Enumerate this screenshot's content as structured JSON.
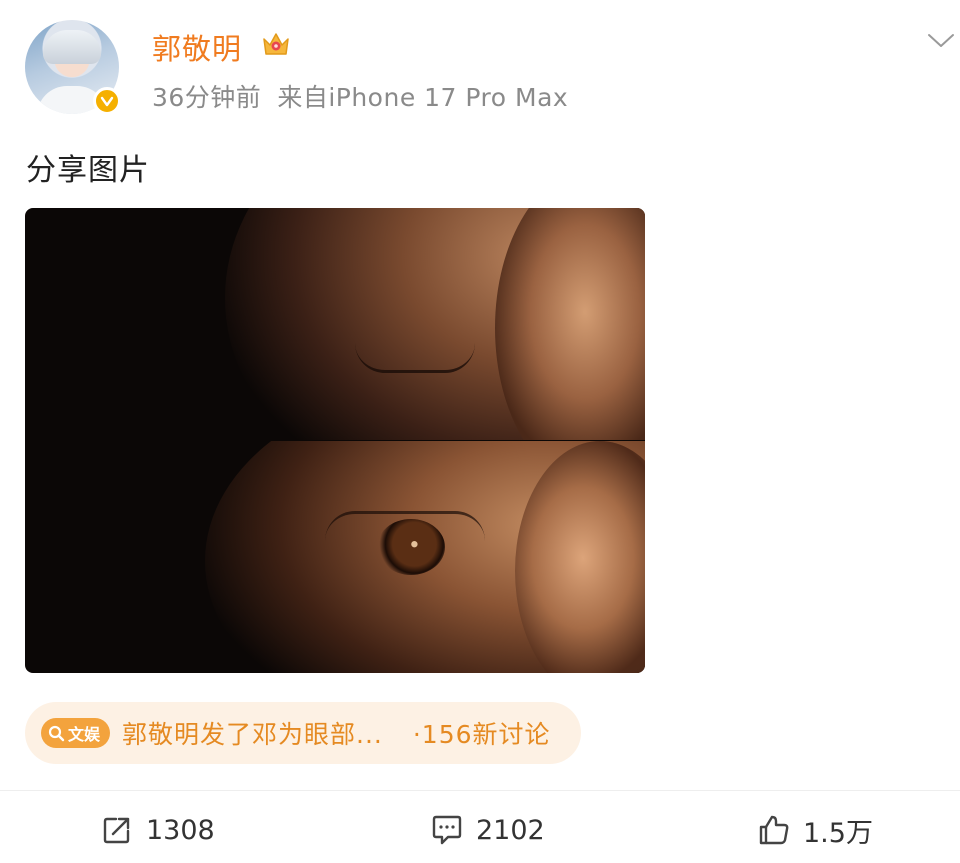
{
  "post": {
    "author": "郭敬明",
    "time": "36分钟前",
    "source": "来自iPhone 17 Pro Max",
    "text": "分享图片"
  },
  "topic": {
    "badge": "文娱",
    "title": "郭敬明发了邓为眼部...",
    "count": "·156新讨论"
  },
  "actions": {
    "reposts": "1308",
    "comments": "2102",
    "likes": "1.5万"
  },
  "colors": {
    "username": "#f07b1f",
    "topic_text": "#e58a22",
    "topic_bg": "#fdf1e4",
    "badge_bg": "#f3a33d"
  }
}
